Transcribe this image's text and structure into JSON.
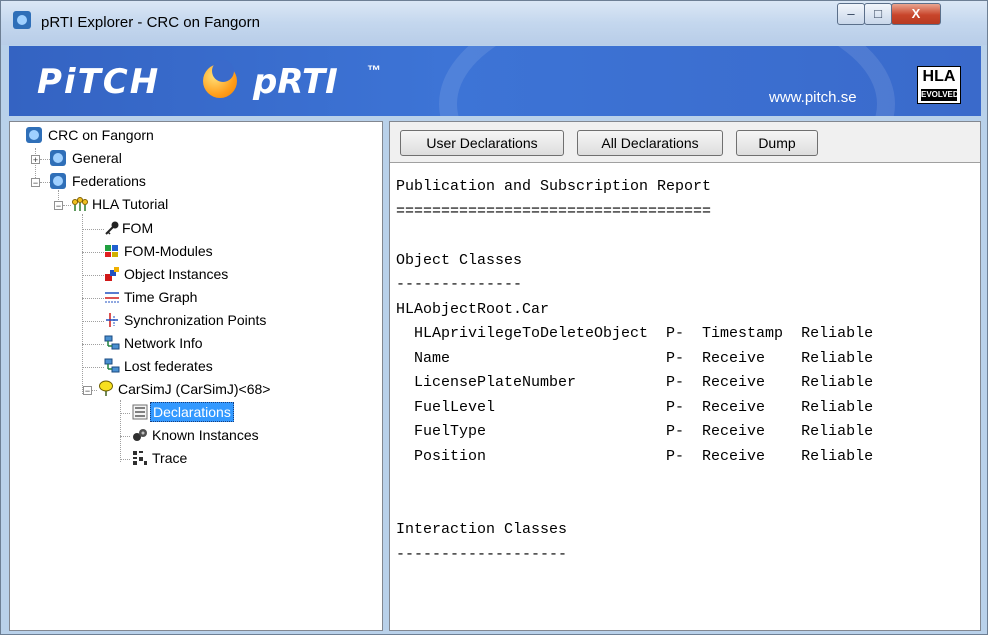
{
  "window": {
    "title": "pRTI Explorer - CRC on Fangorn",
    "minimize": "–",
    "maximize": "□",
    "close": "X"
  },
  "banner": {
    "logo": "PiTCH",
    "product": "pRTI",
    "trademark": "™",
    "url": "www.pitch.se",
    "badge_top": "HLA",
    "badge_bottom": "EVOLVED"
  },
  "tree": {
    "root": "CRC on Fangorn",
    "general": "General",
    "federations": "Federations",
    "federation": "HLA Tutorial",
    "fom": "FOM",
    "fom_modules": "FOM-Modules",
    "object_instances": "Object Instances",
    "time_graph": "Time Graph",
    "sync_points": "Synchronization Points",
    "network_info": "Network Info",
    "lost_federates": "Lost federates",
    "federate": "CarSimJ (CarSimJ)<68>",
    "declarations": "Declarations",
    "known_instances": "Known Instances",
    "trace": "Trace"
  },
  "toolbar": {
    "user_declarations": "User Declarations",
    "all_declarations": "All Declarations",
    "dump": "Dump"
  },
  "report": {
    "text": "Publication and Subscription Report\n===================================\n\nObject Classes\n--------------\nHLAobjectRoot.Car\n  HLAprivilegeToDeleteObject  P-  Timestamp  Reliable\n  Name                        P-  Receive    Reliable\n  LicensePlateNumber          P-  Receive    Reliable\n  FuelLevel                   P-  Receive    Reliable\n  FuelType                    P-  Receive    Reliable\n  Position                    P-  Receive    Reliable\n\n\nInteraction Classes\n-------------------"
  },
  "colors": {
    "banner": "#3a6acb",
    "selection": "#3399ff",
    "close_button": "#c8452b"
  }
}
